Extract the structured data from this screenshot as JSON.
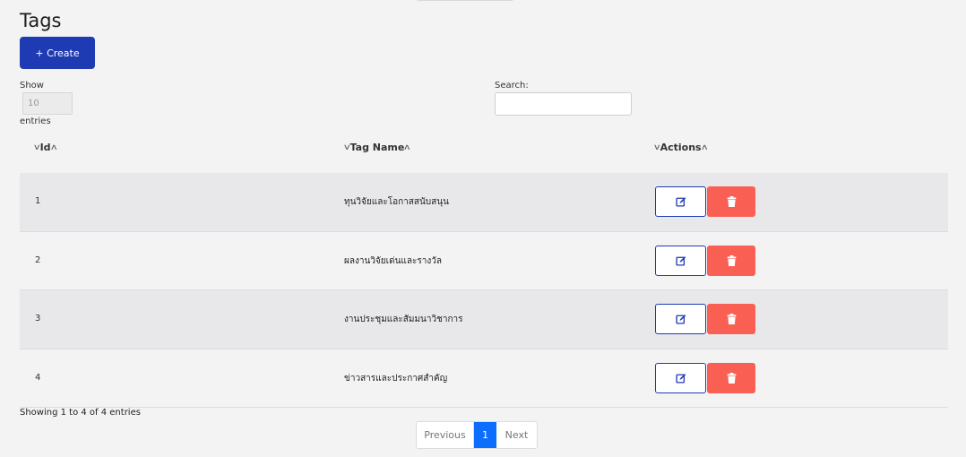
{
  "page": {
    "title": "Tags"
  },
  "toolbar": {
    "create_label": "+ Create"
  },
  "length_control": {
    "show_label": "Show",
    "value": "10",
    "entries_label": "entries"
  },
  "search": {
    "label": "Search:",
    "value": ""
  },
  "table": {
    "columns": [
      {
        "label": "Id"
      },
      {
        "label": "Tag Name"
      },
      {
        "label": "Actions"
      }
    ],
    "rows": [
      {
        "id": "1",
        "name": "ทุนวิจัยและโอกาสสนับสนุน"
      },
      {
        "id": "2",
        "name": "ผลงานวิจัยเด่นและรางวัล"
      },
      {
        "id": "3",
        "name": "งานประชุมและสัมมนาวิชาการ"
      },
      {
        "id": "4",
        "name": "ข่าวสารและประกาศสำคัญ"
      }
    ],
    "action_icons": {
      "edit": "edit-icon",
      "delete": "trash-icon"
    }
  },
  "footer": {
    "info": "Showing 1 to 4 of 4 entries"
  },
  "pagination": {
    "previous": "Previous",
    "current": "1",
    "next": "Next"
  },
  "colors": {
    "primary": "#1f3bb3",
    "danger": "#f95f53",
    "page_active": "#0d6efd"
  }
}
